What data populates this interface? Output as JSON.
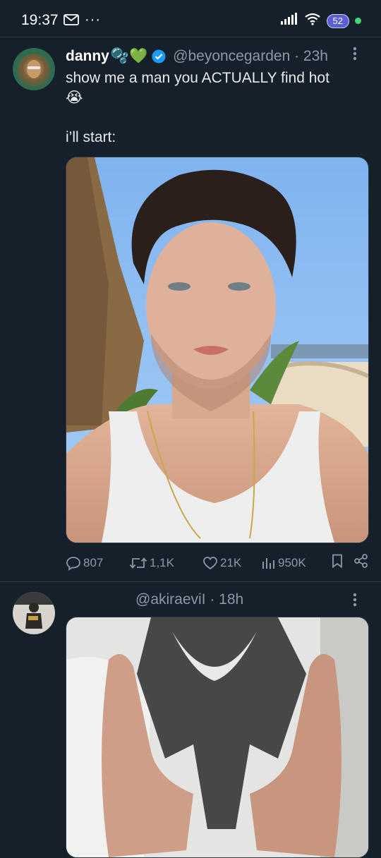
{
  "status_bar": {
    "time": "19:37",
    "battery": "52"
  },
  "tweet1": {
    "display_name": "danny",
    "name_emoji": "🫧💚",
    "handle": "@beyoncegarden · 23h",
    "text_line1": "show me a man you ACTUALLY find hot",
    "text_emoji": "😭",
    "text_line2": "i’ll start:",
    "stats": {
      "replies": "807",
      "retweets": "1,1K",
      "likes": "21K",
      "views": "950K"
    }
  },
  "tweet2": {
    "handle": "@akiraeviI · 18h"
  },
  "colors": {
    "background": "#16202b",
    "verified": "#1d9bf0",
    "muted": "#8b98a5"
  },
  "icons": [
    "mail-icon",
    "signal-icon",
    "wifi-icon",
    "battery-icon",
    "verified-icon",
    "more-icon",
    "reply-icon",
    "retweet-icon",
    "like-icon",
    "views-icon",
    "bookmark-icon",
    "share-icon"
  ]
}
